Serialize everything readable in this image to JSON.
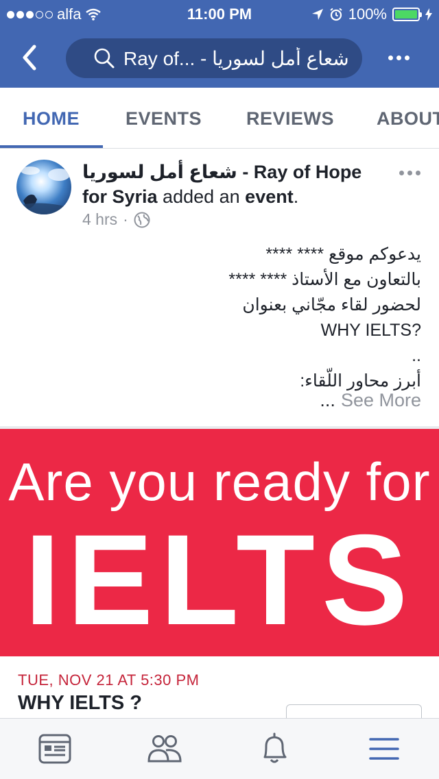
{
  "status_bar": {
    "carrier": "alfa",
    "time": "11:00 PM",
    "battery": "100%",
    "signal_bars_filled": 3,
    "signal_bars_total": 5,
    "battery_level": 1.0,
    "colors": {
      "battery_fill": "#4cd964"
    }
  },
  "nav": {
    "search_text": "Ray of... - شعاع أمل لسوريا",
    "back_icon": "chevron-left-icon",
    "more_icon": "more-horizontal-icon"
  },
  "tabs": [
    {
      "label": "HOME",
      "active": true
    },
    {
      "label": "EVENTS",
      "active": false
    },
    {
      "label": "REVIEWS",
      "active": false
    },
    {
      "label": "ABOUT",
      "active": false
    }
  ],
  "post": {
    "page_name": "شعاع أمل لسوريا - Ray of Hope for Syria",
    "action_pre": " added an ",
    "action_obj": "event",
    "action_post": ".",
    "time": "4 hrs",
    "privacy_icon": "globe-icon",
    "body_lines": [
      "يدعوكم موقع **** ****",
      "بالتعاون مع الأستاذ **** ****",
      "لحضور لقاء مجّاني بعنوان",
      "WHY IELTS?",
      "..",
      "أبرز محاور اللّقاء:"
    ],
    "ellipsis": "...",
    "see_more": "See More"
  },
  "banner": {
    "line1": "Are you ready for",
    "line2": "IELTS",
    "colors": {
      "background": "#ec2846",
      "text": "#ffffff"
    }
  },
  "event": {
    "date": "TUE, NOV 21 AT 5:30 PM",
    "name": "WHY IELTS ?"
  },
  "bottom_bar": [
    {
      "icon": "news-feed-icon"
    },
    {
      "icon": "friends-icon"
    },
    {
      "icon": "notifications-bell-icon"
    },
    {
      "icon": "menu-icon"
    }
  ],
  "colors": {
    "brand": "#4267b2",
    "search_bg": "#2f4b85",
    "event_date": "#c5243a"
  }
}
